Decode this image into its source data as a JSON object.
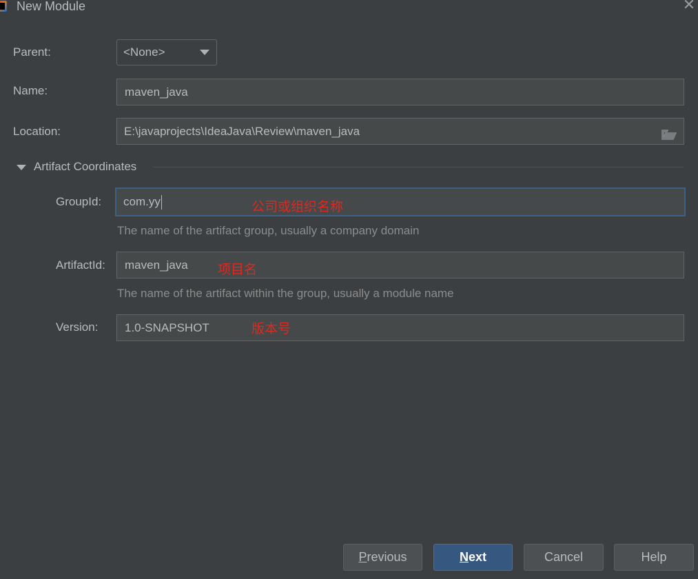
{
  "window": {
    "title": "New Module",
    "close_icon": "close-icon"
  },
  "form": {
    "parent": {
      "label": "Parent:",
      "value": "<None>"
    },
    "name": {
      "label": "Name:",
      "value": "maven_java"
    },
    "location": {
      "label": "Location:",
      "value": "E:\\javaprojects\\IdeaJava\\Review\\maven_java",
      "icon": "folder-icon"
    }
  },
  "artifact": {
    "section_title": "Artifact Coordinates",
    "group_id": {
      "label": "GroupId:",
      "value": "com.yy",
      "annotation": "公司或组织名称",
      "hint": "The name of the artifact group, usually a company domain"
    },
    "artifact_id": {
      "label": "ArtifactId:",
      "value": "maven_java",
      "annotation": "项目名",
      "hint": "The name of the artifact within the group, usually a module name"
    },
    "version": {
      "label": "Version:",
      "value": "1.0-SNAPSHOT",
      "annotation": "版本号"
    }
  },
  "buttons": {
    "previous": {
      "mnemonic": "P",
      "rest": "revious"
    },
    "next": {
      "mnemonic": "N",
      "rest": "ext"
    },
    "cancel": "Cancel",
    "help": "Help"
  },
  "colors": {
    "background": "#3c3f41",
    "field_bg": "#45494a",
    "focus_border": "#3d6185",
    "primary_button": "#365880",
    "annotation_red": "#e0281f"
  }
}
